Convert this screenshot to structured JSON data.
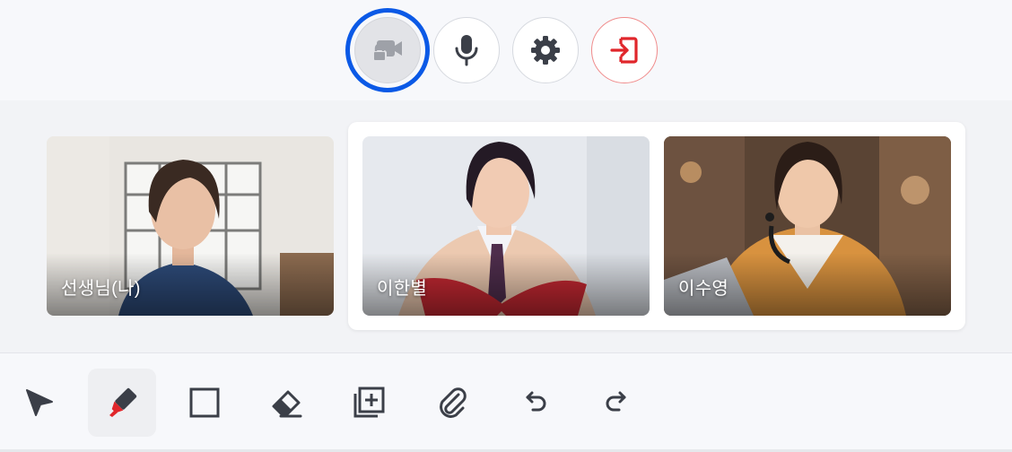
{
  "controls": {
    "camera": {
      "icon": "camera-locked-icon",
      "state": "locked"
    },
    "mic": {
      "icon": "mic-icon"
    },
    "settings": {
      "icon": "gear-icon"
    },
    "leave": {
      "icon": "exit-icon",
      "color": "#e0262b"
    },
    "focus_color": "#0b59e6"
  },
  "participants": {
    "teacher": {
      "name": "선생님(나)"
    },
    "students": [
      {
        "name": "이한별"
      },
      {
        "name": "이수영"
      }
    ]
  },
  "toolbar": {
    "tools": [
      {
        "icon": "pointer-icon",
        "active": false
      },
      {
        "icon": "highlighter-icon",
        "active": true
      },
      {
        "icon": "rectangle-icon",
        "active": false
      },
      {
        "icon": "eraser-icon",
        "active": false
      },
      {
        "icon": "add-page-icon",
        "active": false
      },
      {
        "icon": "attachment-icon",
        "active": false
      },
      {
        "icon": "undo-icon",
        "active": false
      },
      {
        "icon": "redo-icon",
        "active": false
      }
    ],
    "accent_color": "#e0262b",
    "icon_color": "#3b3f48"
  }
}
